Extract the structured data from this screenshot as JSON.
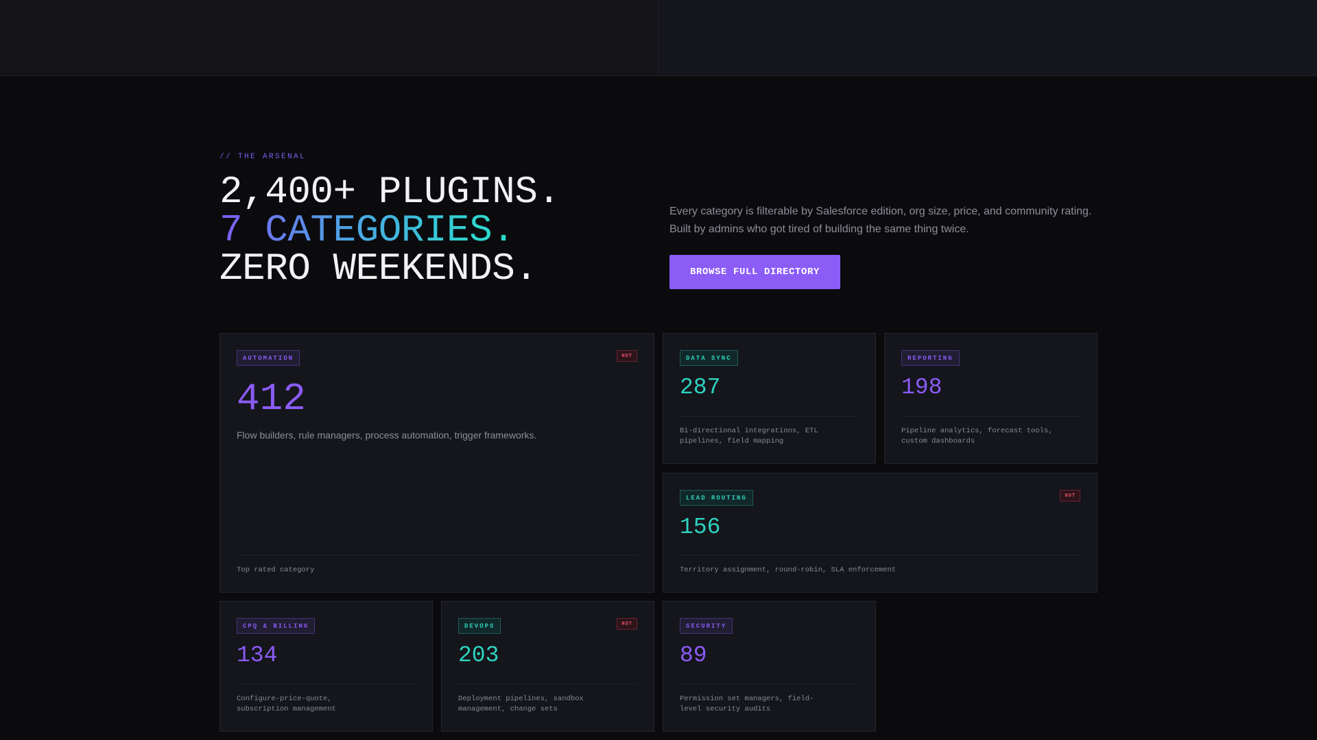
{
  "hero": {
    "eyebrow": "// THE ARSENAL",
    "line1": "2,400+ PLUGINS.",
    "line2": "7 CATEGORIES.",
    "line3": "ZERO WEEKENDS.",
    "intro": "Every category is filterable by Salesforce edition, org size, price, and community rating. Built by admins who got tired of building the same thing twice.",
    "cta_label": "BROWSE FULL DIRECTORY"
  },
  "hot_label": "HOT",
  "categories": [
    {
      "tag": "AUTOMATION",
      "count": "412",
      "description": "Flow builders, rule managers, process automation, trigger frameworks.",
      "footer": "Top rated category",
      "hot": true,
      "accent": "#8b5cf6"
    },
    {
      "tag": "DATA SYNC",
      "count": "287",
      "description": "Bi-directional integrations, ETL pipelines, field mapping",
      "hot": false,
      "accent": "#2dd4bf"
    },
    {
      "tag": "REPORTING",
      "count": "198",
      "description": "Pipeline analytics, forecast tools, custom dashboards",
      "hot": false,
      "accent": "#8b5cf6"
    },
    {
      "tag": "LEAD ROUTING",
      "count": "156",
      "description": "Territory assignment, round-robin, SLA enforcement",
      "hot": true,
      "accent": "#2dd4bf"
    },
    {
      "tag": "CPQ & BILLING",
      "count": "134",
      "description": "Configure-price-quote, subscription management",
      "hot": false,
      "accent": "#8b5cf6"
    },
    {
      "tag": "DEVOPS",
      "count": "203",
      "description": "Deployment pipelines, sandbox management, change sets",
      "hot": true,
      "accent": "#2dd4bf"
    },
    {
      "tag": "SECURITY",
      "count": "89",
      "description": "Permission set managers, field-level security audits",
      "hot": false,
      "accent": "#8b5cf6"
    }
  ]
}
